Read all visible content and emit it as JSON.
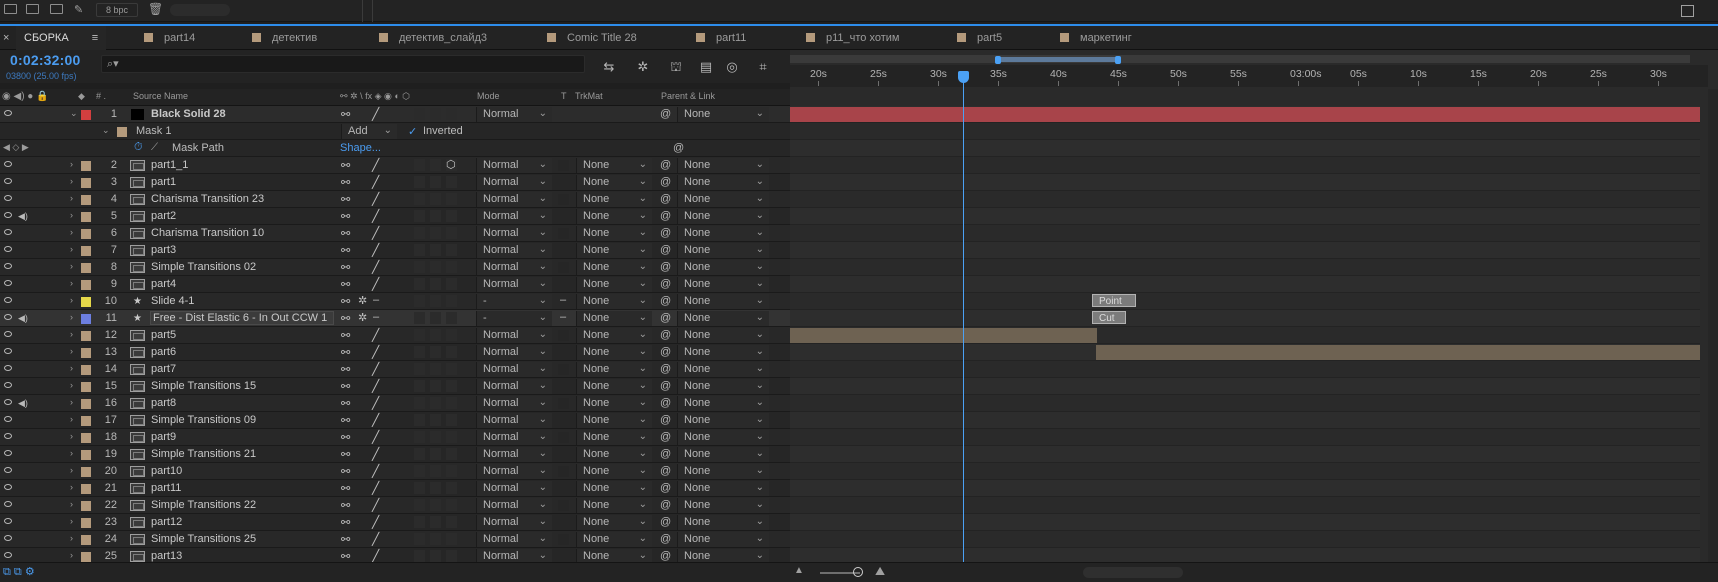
{
  "toolbar": {
    "bpc_label": "8 bpc"
  },
  "tabs": [
    {
      "label": "СБОРКА",
      "active": true
    },
    {
      "label": "part14"
    },
    {
      "label": "детектив"
    },
    {
      "label": "детектив_слайд3"
    },
    {
      "label": "Comic Title 28"
    },
    {
      "label": "part11"
    },
    {
      "label": "p11_что хотим"
    },
    {
      "label": "part5"
    },
    {
      "label": "маркетинг"
    }
  ],
  "timecode": {
    "value": "0:02:32:00",
    "frames": "03800 (25.00 fps)"
  },
  "search": {
    "placeholder": ""
  },
  "columns": {
    "source_name": "Source Name",
    "mode": "Mode",
    "t": "T",
    "trkmat": "TrkMat",
    "parent": "Parent & Link"
  },
  "layer1": {
    "num": "1",
    "name": "Black Solid 28",
    "mode": "Normal",
    "parent": "None",
    "color": "#d33f3f"
  },
  "mask": {
    "name": "Mask 1",
    "mode": "Add",
    "inverted_label": "Inverted",
    "path_label": "Mask Path",
    "path_value": "Shape..."
  },
  "layers": [
    {
      "num": "2",
      "name": "part1_1",
      "mode": "Normal",
      "trkmat": "None",
      "parent": "None",
      "color": "#b49a7c"
    },
    {
      "num": "3",
      "name": "part1",
      "mode": "Normal",
      "trkmat": "None",
      "parent": "None",
      "color": "#b49a7c"
    },
    {
      "num": "4",
      "name": "Charisma Transition 23",
      "mode": "Normal",
      "trkmat": "None",
      "parent": "None",
      "color": "#b49a7c"
    },
    {
      "num": "5",
      "name": "part2",
      "mode": "Normal",
      "trkmat": "None",
      "parent": "None",
      "color": "#b49a7c"
    },
    {
      "num": "6",
      "name": "Charisma Transition 10",
      "mode": "Normal",
      "trkmat": "None",
      "parent": "None",
      "color": "#b49a7c"
    },
    {
      "num": "7",
      "name": "part3",
      "mode": "Normal",
      "trkmat": "None",
      "parent": "None",
      "color": "#b49a7c"
    },
    {
      "num": "8",
      "name": "Simple Transitions 02",
      "mode": "Normal",
      "trkmat": "None",
      "parent": "None",
      "color": "#b49a7c"
    },
    {
      "num": "9",
      "name": "part4",
      "mode": "Normal",
      "trkmat": "None",
      "parent": "None",
      "color": "#b49a7c"
    },
    {
      "num": "10",
      "name": "Slide 4-1",
      "mode": "-",
      "trkmat": "None",
      "parent": "None",
      "color": "#e6d84a"
    },
    {
      "num": "11",
      "name": "Free - Dist Elastic 6 - In Out CCW 1",
      "mode": "-",
      "trkmat": "None",
      "parent": "None",
      "color": "#6d7fe0"
    },
    {
      "num": "12",
      "name": "part5",
      "mode": "Normal",
      "trkmat": "None",
      "parent": "None",
      "color": "#b49a7c"
    },
    {
      "num": "13",
      "name": "part6",
      "mode": "Normal",
      "trkmat": "None",
      "parent": "None",
      "color": "#b49a7c"
    },
    {
      "num": "14",
      "name": "part7",
      "mode": "Normal",
      "trkmat": "None",
      "parent": "None",
      "color": "#b49a7c"
    },
    {
      "num": "15",
      "name": "Simple Transitions 15",
      "mode": "Normal",
      "trkmat": "None",
      "parent": "None",
      "color": "#b49a7c"
    },
    {
      "num": "16",
      "name": "part8",
      "mode": "Normal",
      "trkmat": "None",
      "parent": "None",
      "color": "#b49a7c"
    },
    {
      "num": "17",
      "name": "Simple Transitions 09",
      "mode": "Normal",
      "trkmat": "None",
      "parent": "None",
      "color": "#b49a7c"
    },
    {
      "num": "18",
      "name": "part9",
      "mode": "Normal",
      "trkmat": "None",
      "parent": "None",
      "color": "#b49a7c"
    },
    {
      "num": "19",
      "name": "Simple Transitions 21",
      "mode": "Normal",
      "trkmat": "None",
      "parent": "None",
      "color": "#b49a7c"
    },
    {
      "num": "20",
      "name": "part10",
      "mode": "Normal",
      "trkmat": "None",
      "parent": "None",
      "color": "#b49a7c"
    },
    {
      "num": "21",
      "name": "part11",
      "mode": "Normal",
      "trkmat": "None",
      "parent": "None",
      "color": "#b49a7c"
    },
    {
      "num": "22",
      "name": "Simple Transitions 22",
      "mode": "Normal",
      "trkmat": "None",
      "parent": "None",
      "color": "#b49a7c"
    },
    {
      "num": "23",
      "name": "part12",
      "mode": "Normal",
      "trkmat": "None",
      "parent": "None",
      "color": "#b49a7c"
    },
    {
      "num": "24",
      "name": "Simple Transitions 25",
      "mode": "Normal",
      "trkmat": "None",
      "parent": "None",
      "color": "#b49a7c"
    },
    {
      "num": "25",
      "name": "part13",
      "mode": "Normal",
      "trkmat": "None",
      "parent": "None",
      "color": "#b49a7c"
    }
  ],
  "ruler": [
    "20s",
    "25s",
    "30s",
    "35s",
    "40s",
    "45s",
    "50s",
    "55s",
    "03:00s",
    "05s",
    "10s",
    "15s",
    "20s",
    "25s",
    "30s"
  ],
  "markers": {
    "point": "Point",
    "cut": "Cut"
  },
  "colors": {
    "accent": "#4b9cf0",
    "solid_bar": "#a8444a",
    "clip_bar": "#6e6252"
  }
}
